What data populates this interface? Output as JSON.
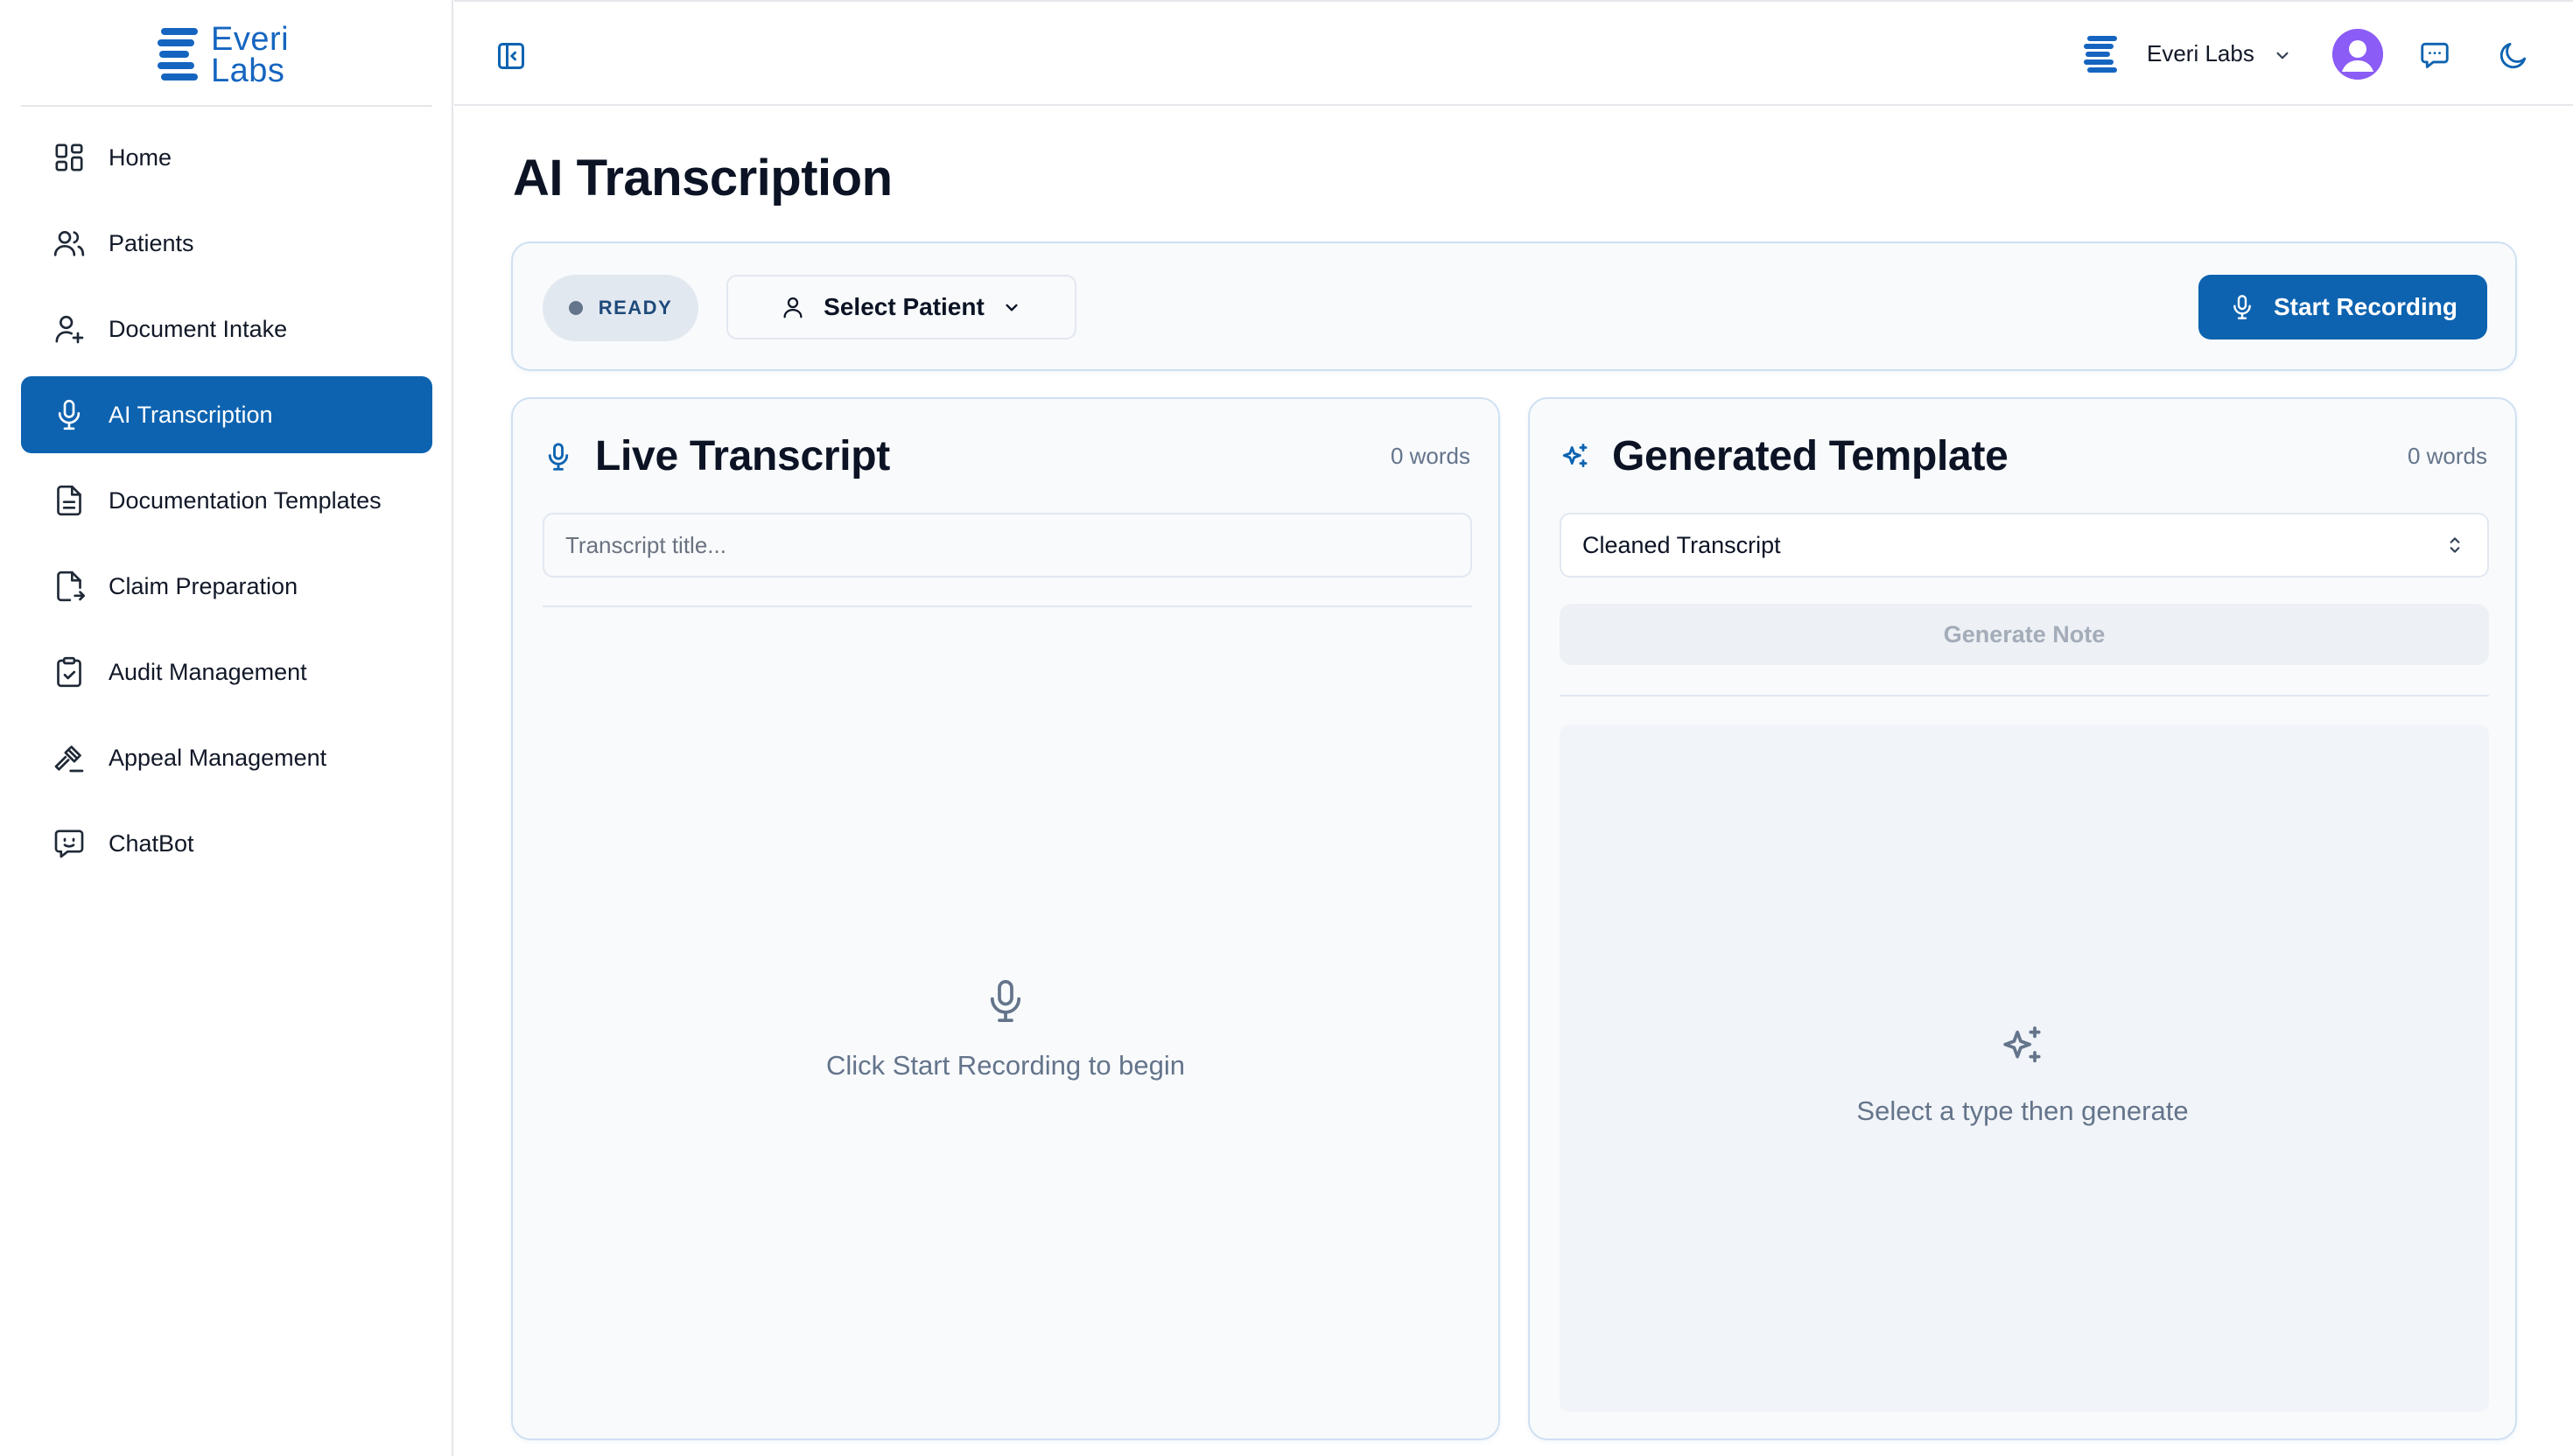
{
  "brand": {
    "logo_line1": "Everi",
    "logo_line2": "Labs",
    "accent_color": "#0d63b0"
  },
  "sidebar": {
    "items": [
      {
        "label": "Home",
        "icon": "layout-grid-icon",
        "active": false
      },
      {
        "label": "Patients",
        "icon": "users-icon",
        "active": false
      },
      {
        "label": "Document Intake",
        "icon": "user-plus-icon",
        "active": false
      },
      {
        "label": "AI Transcription",
        "icon": "microphone-icon",
        "active": true
      },
      {
        "label": "Documentation Templates",
        "icon": "file-text-icon",
        "active": false
      },
      {
        "label": "Claim Preparation",
        "icon": "file-export-icon",
        "active": false
      },
      {
        "label": "Audit Management",
        "icon": "clipboard-check-icon",
        "active": false
      },
      {
        "label": "Appeal Management",
        "icon": "gavel-icon",
        "active": false
      },
      {
        "label": "ChatBot",
        "icon": "chat-bot-icon",
        "active": false
      }
    ]
  },
  "topbar": {
    "org_name": "Everi Labs",
    "avatar_color": "#8b5cf6"
  },
  "main": {
    "title": "AI Transcription",
    "status": "READY",
    "select_patient_label": "Select Patient",
    "start_recording_label": "Start Recording"
  },
  "live_transcript": {
    "title": "Live Transcript",
    "word_count": "0 words",
    "title_placeholder": "Transcript title...",
    "empty_text": "Click Start Recording to begin"
  },
  "generated_template": {
    "title": "Generated Template",
    "word_count": "0 words",
    "selected_type": "Cleaned Transcript",
    "generate_label": "Generate Note",
    "empty_text": "Select a type then generate"
  }
}
